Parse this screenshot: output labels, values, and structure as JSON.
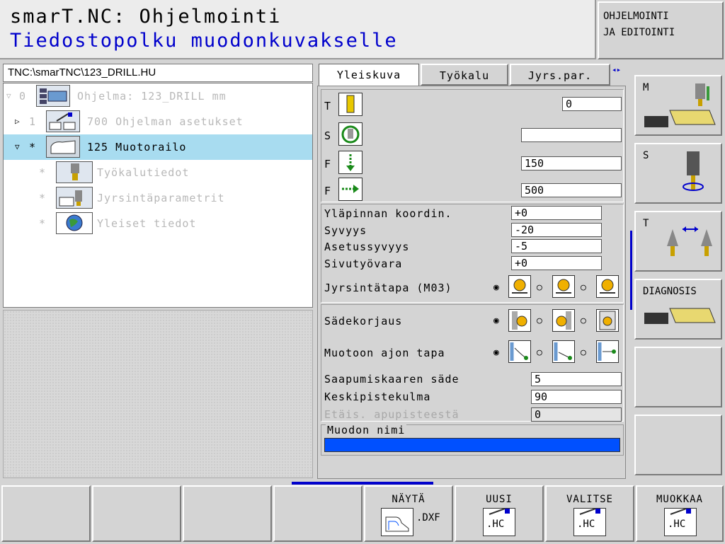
{
  "header": {
    "title": "smarT.NC: Ohjelmointi",
    "subtitle": "Tiedostopolku muodonkuvakselle",
    "mode_line1": "OHJELMOINTI",
    "mode_line2": "JA EDITOINTI"
  },
  "tree": {
    "path": "TNC:\\smarTNC\\123_DRILL.HU",
    "items": [
      {
        "arrow": "▽",
        "num": "0",
        "label": "Ohjelma: 123_DRILL mm",
        "icon": "program-icon"
      },
      {
        "arrow": "▷",
        "num": "1",
        "label": "700 Ohjelman asetukset",
        "icon": "settings-icon"
      },
      {
        "arrow": "▽",
        "num": "*",
        "label": "125 Muotorailo",
        "icon": "contour-icon"
      },
      {
        "arrow": "",
        "num": "*",
        "label": "Työkalutiedot",
        "icon": "tool-data-icon"
      },
      {
        "arrow": "",
        "num": "*",
        "label": "Jyrsintäparametrit",
        "icon": "milling-params-icon"
      },
      {
        "arrow": "",
        "num": "*",
        "label": "Yleiset tiedot",
        "icon": "globe-icon"
      }
    ]
  },
  "tabs": [
    "Yleiskuva",
    "Työkalu",
    "Jyrs.par."
  ],
  "form": {
    "tool": {
      "label": "T",
      "value": "0"
    },
    "spindle": {
      "label": "S",
      "value": ""
    },
    "feed_plunge": {
      "label": "F",
      "value": "150"
    },
    "feed_mill": {
      "label": "F",
      "value": "500"
    },
    "surface_label": "Yläpinnan koordin.",
    "surface_value": "+0",
    "depth_label": "Syvyys",
    "depth_value": "-20",
    "setdepth_label": "Asetussyvyys",
    "setdepth_value": "-5",
    "side_label": "Sivutyövara",
    "side_value": "+0",
    "millmode_label": "Jyrsintätapa (M03)",
    "radius_label": "Sädekorjaus",
    "approach_label": "Muotoon ajon tapa",
    "arcradius_label": "Saapumiskaaren säde",
    "arcradius_value": "5",
    "centerangle_label": "Keskipistekulma",
    "centerangle_value": "90",
    "auxdist_label": "Etäis. apupisteestä",
    "auxdist_value": "0",
    "contourname_label": "Muodon nimi"
  },
  "right_softkeys": [
    "M",
    "S",
    "T",
    "DIAGNOSIS",
    "",
    ""
  ],
  "bottom_softkeys": [
    {
      "label": "",
      "sub": ""
    },
    {
      "label": "",
      "sub": ""
    },
    {
      "label": "",
      "sub": ""
    },
    {
      "label": "",
      "sub": ""
    },
    {
      "label": "NÄYTÄ",
      "sub": ".DXF"
    },
    {
      "label": "UUSI",
      "sub": ".HC"
    },
    {
      "label": "VALITSE",
      "sub": ".HC"
    },
    {
      "label": "MUOKKAA",
      "sub": ".HC"
    }
  ],
  "colors": {
    "accent": "#0000cc",
    "selection": "#a8dcf0",
    "contour_bar": "#0050ff"
  }
}
